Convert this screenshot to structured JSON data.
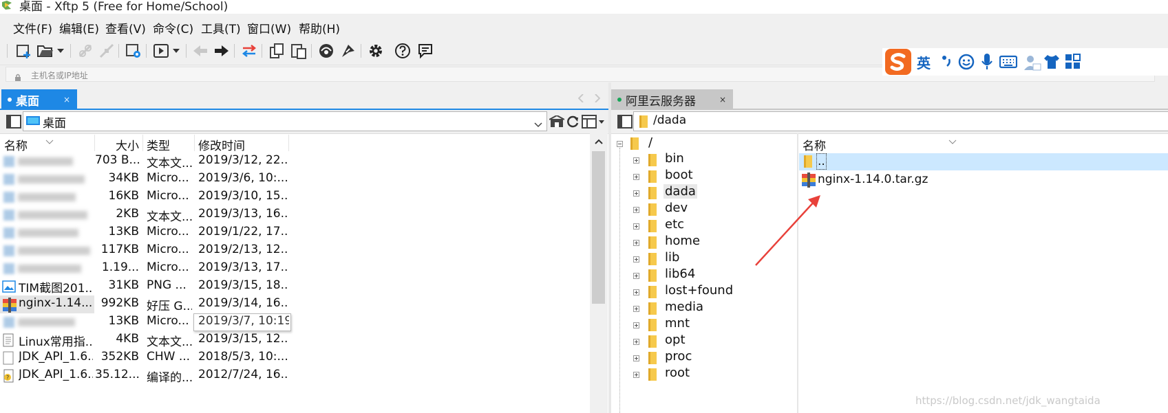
{
  "window": {
    "title": "桌面 - Xftp 5 (Free for Home/School)"
  },
  "menu": [
    "文件(F)",
    "编辑(E)",
    "查看(V)",
    "命令(C)",
    "工具(T)",
    "窗口(W)",
    "帮助(H)"
  ],
  "address": {
    "placeholder": "主机名或IP地址"
  },
  "sogou": {
    "lang": "英"
  },
  "left_panel": {
    "tab_label": "桌面",
    "tab_close": "×",
    "path": "桌面",
    "columns": [
      "名称",
      "大小",
      "类型",
      "修改时间"
    ],
    "rows": [
      {
        "name": " ",
        "size": "703 B...",
        "type": "文本文...",
        "modified": "2019/3/12, 22..."
      },
      {
        "name": " ",
        "size": "34KB",
        "type": "Micro...",
        "modified": "2019/3/6, 10:..."
      },
      {
        "name": " ",
        "size": "16KB",
        "type": "Micro...",
        "modified": "2019/3/10, 15..."
      },
      {
        "name": " ",
        "size": "2KB",
        "type": "文本文...",
        "modified": "2019/3/13, 16..."
      },
      {
        "name": " ",
        "size": "13KB",
        "type": "Micro...",
        "modified": "2019/1/22, 17..."
      },
      {
        "name": " ",
        "size": "117KB",
        "type": "Micro...",
        "modified": "2019/2/13, 12..."
      },
      {
        "name": " ",
        "size": "1.19...",
        "type": "Micro...",
        "modified": "2019/3/13, 17..."
      },
      {
        "name": "TIM截图201...",
        "size": "31KB",
        "type": "PNG ...",
        "modified": "2019/3/15, 18..."
      },
      {
        "name": "nginx-1.14....",
        "size": "992KB",
        "type": "好压 G...",
        "modified": "2019/3/14, 16..."
      },
      {
        "name": " ",
        "size": "13KB",
        "type": "Micro...",
        "modified": "2019/3/7, 10:19"
      },
      {
        "name": "Linux常用指...",
        "size": "4KB",
        "type": "文本文...",
        "modified": "2019/3/15, 12..."
      },
      {
        "name": "JDK_API_1.6...",
        "size": "352KB",
        "type": "CHW ...",
        "modified": "2018/5/3, 10:..."
      },
      {
        "name": "JDK_API_1.6...",
        "size": "35.12...",
        "type": "编译的...",
        "modified": "2012/7/24, 16..."
      }
    ]
  },
  "right_panel": {
    "tab_label": "阿里云服务器",
    "tab_close": "×",
    "path": "/dada",
    "tree_root": "/",
    "tree": [
      "bin",
      "boot",
      "dada",
      "dev",
      "etc",
      "home",
      "lib",
      "lib64",
      "lost+found",
      "media",
      "mnt",
      "opt",
      "proc",
      "root"
    ],
    "file_column": "名称",
    "files": [
      "..",
      "nginx-1.14.0.tar.gz"
    ]
  },
  "watermark": "https://blog.csdn.net/jdk_wangtaida",
  "colors": {
    "tab_active": "#1e88e5",
    "tab_inactive": "#c7c7c7",
    "selection": "#cce8ff",
    "arrow": "#e8413a",
    "folder": "#f6c94c",
    "sogou_orange": "#f26a21",
    "sogou_blue": "#1565c0"
  }
}
